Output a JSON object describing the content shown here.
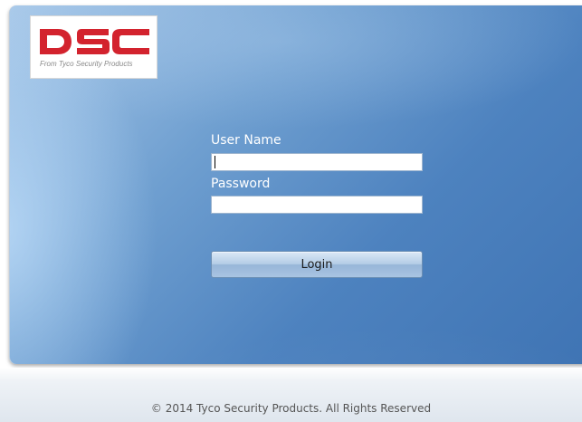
{
  "logo": {
    "brand": "DSC",
    "tagline": "From Tyco Security Products",
    "color": "#d3232e"
  },
  "form": {
    "username_label": "User Name",
    "username_value": "",
    "password_label": "Password",
    "password_value": "",
    "login_label": "Login"
  },
  "footer": {
    "copyright": "© 2014 Tyco Security Products. All Rights Reserved"
  },
  "colors": {
    "panel_blue": "#4d82bf",
    "button_top": "#dbe8f6",
    "button_bottom": "#97b6d8"
  }
}
